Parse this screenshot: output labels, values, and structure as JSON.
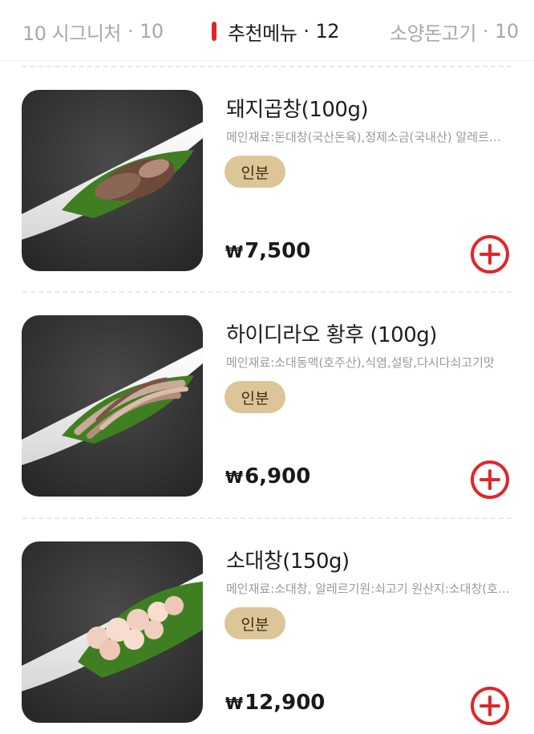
{
  "tabs": [
    {
      "label": "10 시그니처",
      "count": "10",
      "active": false
    },
    {
      "label": "추천메뉴",
      "count": "12",
      "active": true
    },
    {
      "label": "소양돈고기",
      "count": "10",
      "active": false
    }
  ],
  "tab_separator": "·",
  "accent_color": "#e0262a",
  "badge_color": "#dcc596",
  "currency_symbol": "₩",
  "add_icon": "plus-circle-icon",
  "menu": [
    {
      "name": "돼지곱창(100g)",
      "description": "메인재료:돈대창(국산돈육),정제소금(국내산) 알레르기원:돼지고기",
      "badge": "인분",
      "price": "7,500"
    },
    {
      "name": "하이디라오 황후 (100g)",
      "description": "메인재료:소대동맥(호주산),식염,설탕,다시다쇠고기맛",
      "badge": "인분",
      "price": "6,900"
    },
    {
      "name": "소대창(150g)",
      "description": "메인재료:소대창, 알레르기원:쇠고기 원산지:소대창(호주산)",
      "badge": "인분",
      "price": "12,900"
    }
  ]
}
